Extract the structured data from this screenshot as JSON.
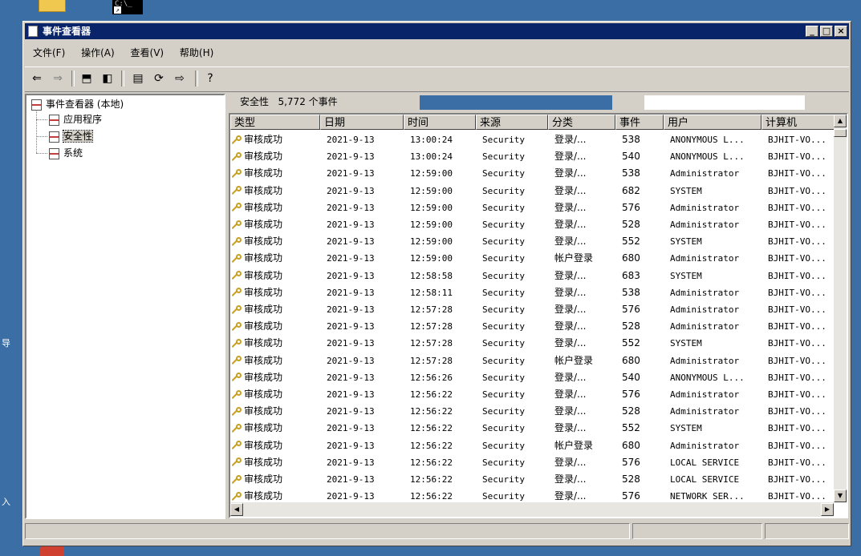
{
  "desktop": {
    "cmd_icon_text": "C:\\_",
    "labels": [
      "导",
      "入"
    ]
  },
  "window": {
    "title": "事件查看器"
  },
  "menubar": {
    "items": [
      "文件(F)",
      "操作(A)",
      "查看(V)",
      "帮助(H)"
    ]
  },
  "tree": {
    "root": "事件查看器 (本地)",
    "items": [
      "应用程序",
      "安全性",
      "系统"
    ],
    "selected": "安全性"
  },
  "panel": {
    "title": "安全性",
    "count": "5,772 个事件"
  },
  "columns": [
    "类型",
    "日期",
    "时间",
    "来源",
    "分类",
    "事件",
    "用户",
    "计算机"
  ],
  "rows": [
    [
      "审核成功",
      "2021-9-13",
      "13:00:24",
      "Security",
      "登录/...",
      "538",
      "ANONYMOUS L...",
      "BJHIT-VO..."
    ],
    [
      "审核成功",
      "2021-9-13",
      "13:00:24",
      "Security",
      "登录/...",
      "540",
      "ANONYMOUS L...",
      "BJHIT-VO..."
    ],
    [
      "审核成功",
      "2021-9-13",
      "12:59:00",
      "Security",
      "登录/...",
      "538",
      "Administrator",
      "BJHIT-VO..."
    ],
    [
      "审核成功",
      "2021-9-13",
      "12:59:00",
      "Security",
      "登录/...",
      "682",
      "SYSTEM",
      "BJHIT-VO..."
    ],
    [
      "审核成功",
      "2021-9-13",
      "12:59:00",
      "Security",
      "登录/...",
      "576",
      "Administrator",
      "BJHIT-VO..."
    ],
    [
      "审核成功",
      "2021-9-13",
      "12:59:00",
      "Security",
      "登录/...",
      "528",
      "Administrator",
      "BJHIT-VO..."
    ],
    [
      "审核成功",
      "2021-9-13",
      "12:59:00",
      "Security",
      "登录/...",
      "552",
      "SYSTEM",
      "BJHIT-VO..."
    ],
    [
      "审核成功",
      "2021-9-13",
      "12:59:00",
      "Security",
      "帐户登录",
      "680",
      "Administrator",
      "BJHIT-VO..."
    ],
    [
      "审核成功",
      "2021-9-13",
      "12:58:58",
      "Security",
      "登录/...",
      "683",
      "SYSTEM",
      "BJHIT-VO..."
    ],
    [
      "审核成功",
      "2021-9-13",
      "12:58:11",
      "Security",
      "登录/...",
      "538",
      "Administrator",
      "BJHIT-VO..."
    ],
    [
      "审核成功",
      "2021-9-13",
      "12:57:28",
      "Security",
      "登录/...",
      "576",
      "Administrator",
      "BJHIT-VO..."
    ],
    [
      "审核成功",
      "2021-9-13",
      "12:57:28",
      "Security",
      "登录/...",
      "528",
      "Administrator",
      "BJHIT-VO..."
    ],
    [
      "审核成功",
      "2021-9-13",
      "12:57:28",
      "Security",
      "登录/...",
      "552",
      "SYSTEM",
      "BJHIT-VO..."
    ],
    [
      "审核成功",
      "2021-9-13",
      "12:57:28",
      "Security",
      "帐户登录",
      "680",
      "Administrator",
      "BJHIT-VO..."
    ],
    [
      "审核成功",
      "2021-9-13",
      "12:56:26",
      "Security",
      "登录/...",
      "540",
      "ANONYMOUS L...",
      "BJHIT-VO..."
    ],
    [
      "审核成功",
      "2021-9-13",
      "12:56:22",
      "Security",
      "登录/...",
      "576",
      "Administrator",
      "BJHIT-VO..."
    ],
    [
      "审核成功",
      "2021-9-13",
      "12:56:22",
      "Security",
      "登录/...",
      "528",
      "Administrator",
      "BJHIT-VO..."
    ],
    [
      "审核成功",
      "2021-9-13",
      "12:56:22",
      "Security",
      "登录/...",
      "552",
      "SYSTEM",
      "BJHIT-VO..."
    ],
    [
      "审核成功",
      "2021-9-13",
      "12:56:22",
      "Security",
      "帐户登录",
      "680",
      "Administrator",
      "BJHIT-VO..."
    ],
    [
      "审核成功",
      "2021-9-13",
      "12:56:22",
      "Security",
      "登录/...",
      "576",
      "LOCAL SERVICE",
      "BJHIT-VO..."
    ],
    [
      "审核成功",
      "2021-9-13",
      "12:56:22",
      "Security",
      "登录/...",
      "528",
      "LOCAL SERVICE",
      "BJHIT-VO..."
    ],
    [
      "审核成功",
      "2021-9-13",
      "12:56:22",
      "Security",
      "登录/...",
      "576",
      "NETWORK SER...",
      "BJHIT-VO..."
    ]
  ],
  "colors": {
    "desktop": "#3a6ea5",
    "titlebar": "#0a246a",
    "chrome": "#d4d0c8",
    "key_icon": "#c8a020"
  }
}
